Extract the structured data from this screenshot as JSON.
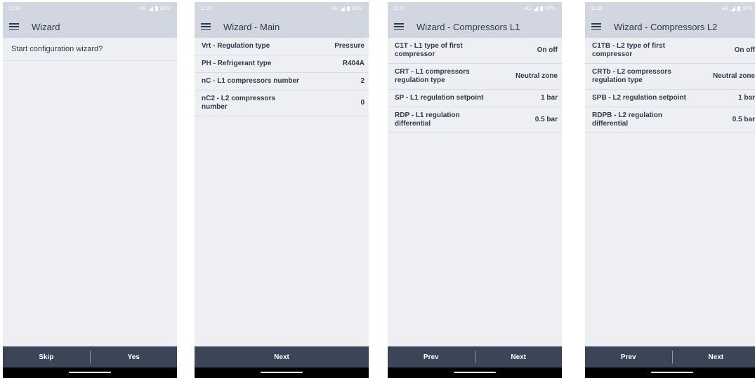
{
  "screens": [
    {
      "status": {
        "time": "11:32",
        "signal": "4G",
        "battery": "92%"
      },
      "title": "Wizard",
      "prompt": "Start configuration wizard?",
      "rows": [],
      "buttons": [
        "Skip",
        "Yes"
      ]
    },
    {
      "status": {
        "time": "11:27",
        "signal": "4G",
        "battery": "92%"
      },
      "title": "Wizard - Main",
      "prompt": "",
      "rows": [
        {
          "label": "Vrt - Regulation type",
          "value": "Pressure"
        },
        {
          "label": "PH - Refrigerant type",
          "value": "R404A"
        },
        {
          "label": "nC - L1 compressors number",
          "value": "2"
        },
        {
          "label": "nC2 - L2 compressors number",
          "value": "0"
        }
      ],
      "buttons": [
        "Next"
      ]
    },
    {
      "status": {
        "time": "11:27",
        "signal": "4G",
        "battery": "92%"
      },
      "title": "Wizard - Compressors L1",
      "prompt": "",
      "rows": [
        {
          "label": "C1T - L1 type of first compressor",
          "value": "On off"
        },
        {
          "label": "CRT - L1 compressors regulation type",
          "value": "Neutral zone"
        },
        {
          "label": "SP - L1 regulation setpoint",
          "value": "1 bar"
        },
        {
          "label": "RDP - L1 regulation differential",
          "value": "0.5 bar"
        }
      ],
      "buttons": [
        "Prev",
        "Next"
      ]
    },
    {
      "status": {
        "time": "11:28",
        "signal": "4G",
        "battery": "92%"
      },
      "title": "Wizard - Compressors L2",
      "prompt": "",
      "rows": [
        {
          "label": "C1TB - L2 type of first compressor",
          "value": "On off"
        },
        {
          "label": "CRTb - L2 compressors regulation type",
          "value": "Neutral zone"
        },
        {
          "label": "SPB - L2 regulation setpoint",
          "value": "1 bar"
        },
        {
          "label": "RDPB - L2 regulation differential",
          "value": "0.5 bar"
        }
      ],
      "buttons": [
        "Prev",
        "Next"
      ]
    }
  ],
  "colors": {
    "appbar": "#d2d6e0",
    "background": "#eeeff3",
    "footer": "#3a4658",
    "text": "#2e3a4c"
  }
}
